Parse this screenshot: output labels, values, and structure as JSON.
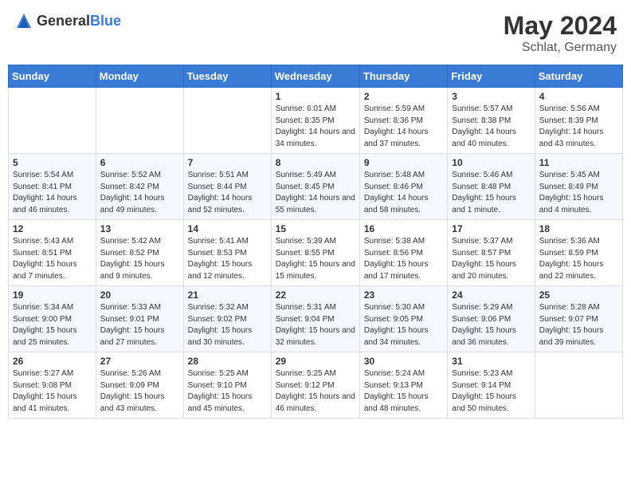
{
  "header": {
    "logo_general": "General",
    "logo_blue": "Blue",
    "title": "May 2024",
    "subtitle": "Schlat, Germany"
  },
  "calendar": {
    "days_of_week": [
      "Sunday",
      "Monday",
      "Tuesday",
      "Wednesday",
      "Thursday",
      "Friday",
      "Saturday"
    ],
    "weeks": [
      [
        {
          "day": "",
          "info": ""
        },
        {
          "day": "",
          "info": ""
        },
        {
          "day": "",
          "info": ""
        },
        {
          "day": "1",
          "info": "Sunrise: 6:01 AM\nSunset: 8:35 PM\nDaylight: 14 hours and 34 minutes."
        },
        {
          "day": "2",
          "info": "Sunrise: 5:59 AM\nSunset: 8:36 PM\nDaylight: 14 hours and 37 minutes."
        },
        {
          "day": "3",
          "info": "Sunrise: 5:57 AM\nSunset: 8:38 PM\nDaylight: 14 hours and 40 minutes."
        },
        {
          "day": "4",
          "info": "Sunrise: 5:56 AM\nSunset: 8:39 PM\nDaylight: 14 hours and 43 minutes."
        }
      ],
      [
        {
          "day": "5",
          "info": "Sunrise: 5:54 AM\nSunset: 8:41 PM\nDaylight: 14 hours and 46 minutes."
        },
        {
          "day": "6",
          "info": "Sunrise: 5:52 AM\nSunset: 8:42 PM\nDaylight: 14 hours and 49 minutes."
        },
        {
          "day": "7",
          "info": "Sunrise: 5:51 AM\nSunset: 8:44 PM\nDaylight: 14 hours and 52 minutes."
        },
        {
          "day": "8",
          "info": "Sunrise: 5:49 AM\nSunset: 8:45 PM\nDaylight: 14 hours and 55 minutes."
        },
        {
          "day": "9",
          "info": "Sunrise: 5:48 AM\nSunset: 8:46 PM\nDaylight: 14 hours and 58 minutes."
        },
        {
          "day": "10",
          "info": "Sunrise: 5:46 AM\nSunset: 8:48 PM\nDaylight: 15 hours and 1 minute."
        },
        {
          "day": "11",
          "info": "Sunrise: 5:45 AM\nSunset: 8:49 PM\nDaylight: 15 hours and 4 minutes."
        }
      ],
      [
        {
          "day": "12",
          "info": "Sunrise: 5:43 AM\nSunset: 8:51 PM\nDaylight: 15 hours and 7 minutes."
        },
        {
          "day": "13",
          "info": "Sunrise: 5:42 AM\nSunset: 8:52 PM\nDaylight: 15 hours and 9 minutes."
        },
        {
          "day": "14",
          "info": "Sunrise: 5:41 AM\nSunset: 8:53 PM\nDaylight: 15 hours and 12 minutes."
        },
        {
          "day": "15",
          "info": "Sunrise: 5:39 AM\nSunset: 8:55 PM\nDaylight: 15 hours and 15 minutes."
        },
        {
          "day": "16",
          "info": "Sunrise: 5:38 AM\nSunset: 8:56 PM\nDaylight: 15 hours and 17 minutes."
        },
        {
          "day": "17",
          "info": "Sunrise: 5:37 AM\nSunset: 8:57 PM\nDaylight: 15 hours and 20 minutes."
        },
        {
          "day": "18",
          "info": "Sunrise: 5:36 AM\nSunset: 8:59 PM\nDaylight: 15 hours and 22 minutes."
        }
      ],
      [
        {
          "day": "19",
          "info": "Sunrise: 5:34 AM\nSunset: 9:00 PM\nDaylight: 15 hours and 25 minutes."
        },
        {
          "day": "20",
          "info": "Sunrise: 5:33 AM\nSunset: 9:01 PM\nDaylight: 15 hours and 27 minutes."
        },
        {
          "day": "21",
          "info": "Sunrise: 5:32 AM\nSunset: 9:02 PM\nDaylight: 15 hours and 30 minutes."
        },
        {
          "day": "22",
          "info": "Sunrise: 5:31 AM\nSunset: 9:04 PM\nDaylight: 15 hours and 32 minutes."
        },
        {
          "day": "23",
          "info": "Sunrise: 5:30 AM\nSunset: 9:05 PM\nDaylight: 15 hours and 34 minutes."
        },
        {
          "day": "24",
          "info": "Sunrise: 5:29 AM\nSunset: 9:06 PM\nDaylight: 15 hours and 36 minutes."
        },
        {
          "day": "25",
          "info": "Sunrise: 5:28 AM\nSunset: 9:07 PM\nDaylight: 15 hours and 39 minutes."
        }
      ],
      [
        {
          "day": "26",
          "info": "Sunrise: 5:27 AM\nSunset: 9:08 PM\nDaylight: 15 hours and 41 minutes."
        },
        {
          "day": "27",
          "info": "Sunrise: 5:26 AM\nSunset: 9:09 PM\nDaylight: 15 hours and 43 minutes."
        },
        {
          "day": "28",
          "info": "Sunrise: 5:25 AM\nSunset: 9:10 PM\nDaylight: 15 hours and 45 minutes."
        },
        {
          "day": "29",
          "info": "Sunrise: 5:25 AM\nSunset: 9:12 PM\nDaylight: 15 hours and 46 minutes."
        },
        {
          "day": "30",
          "info": "Sunrise: 5:24 AM\nSunset: 9:13 PM\nDaylight: 15 hours and 48 minutes."
        },
        {
          "day": "31",
          "info": "Sunrise: 5:23 AM\nSunset: 9:14 PM\nDaylight: 15 hours and 50 minutes."
        },
        {
          "day": "",
          "info": ""
        }
      ]
    ]
  }
}
